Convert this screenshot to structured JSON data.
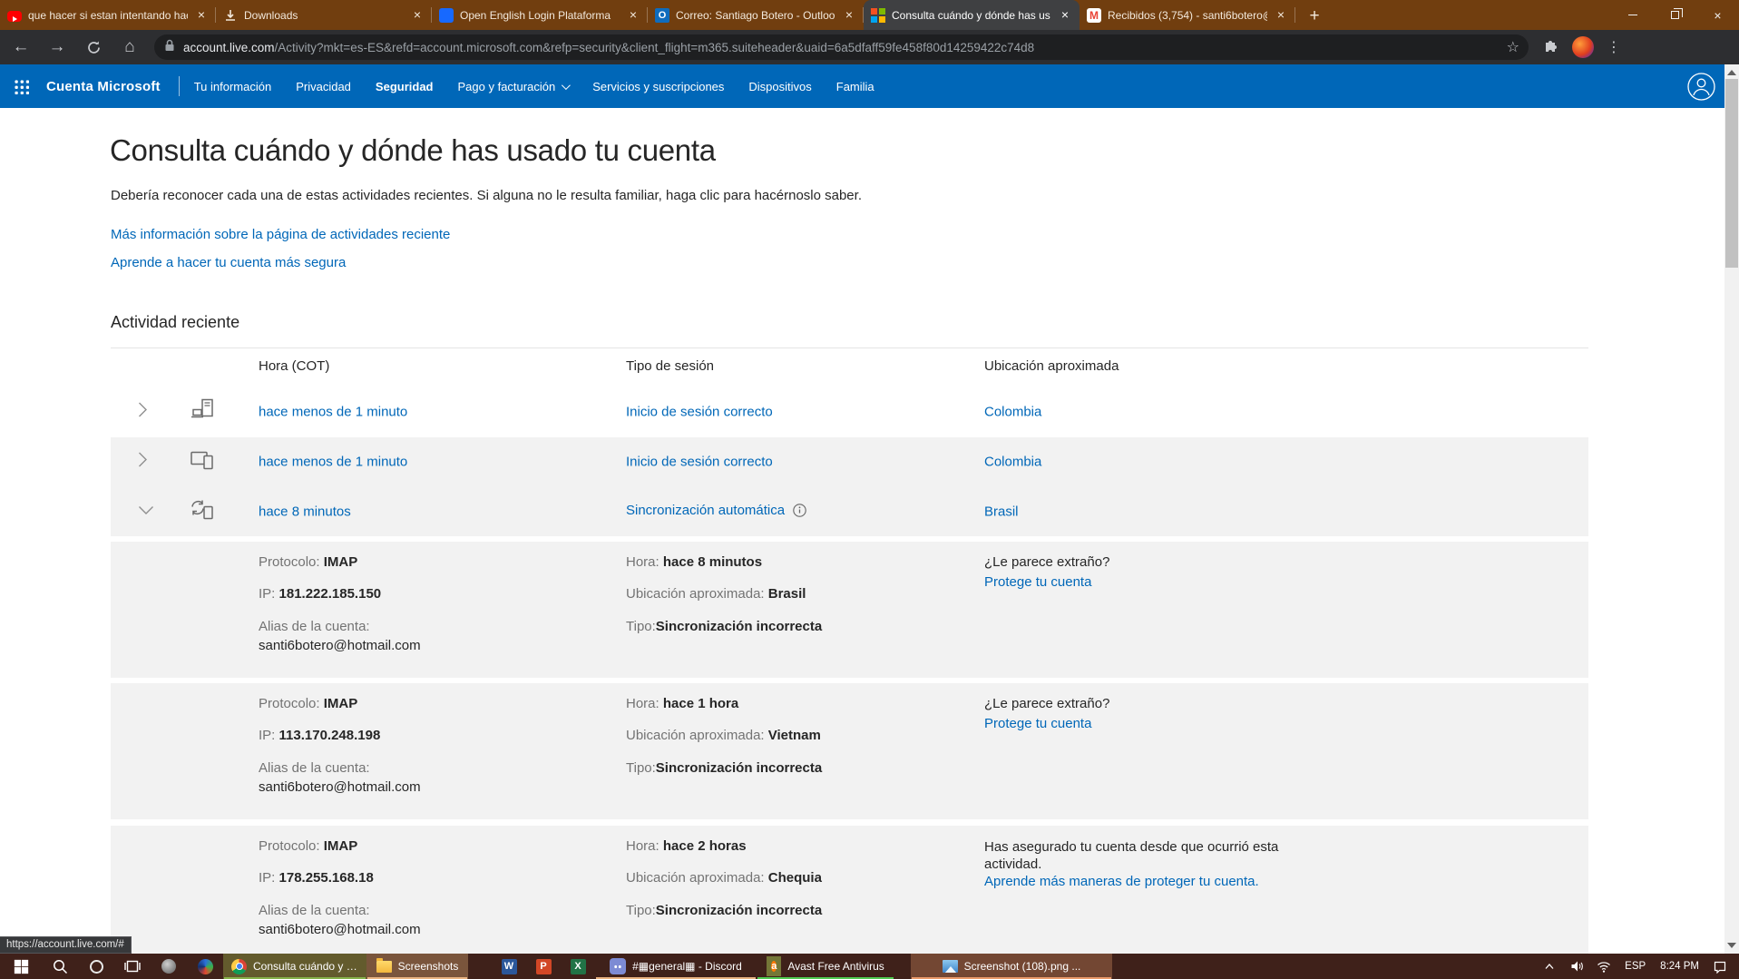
{
  "glyphs": {
    "back": "←",
    "forward": "→",
    "home": "⌂",
    "star": "☆",
    "kebab": "⋮",
    "new_tab": "+",
    "close": "×",
    "outlook": "O",
    "gmail": "M",
    "word": "W",
    "powerpoint": "P",
    "excel": "X",
    "avast": "a"
  },
  "browser": {
    "tabs": [
      {
        "title": "que hacer si estan intentando hac"
      },
      {
        "title": "Downloads"
      },
      {
        "title": "Open English Login Plataforma"
      },
      {
        "title": "Correo: Santiago Botero - Outloo"
      },
      {
        "title": "Consulta cuándo y dónde has us"
      },
      {
        "title": "Recibidos (3,754) - santi6botero@"
      }
    ],
    "url_domain": "account.live.com",
    "url_path": "/Activity?mkt=es-ES&refd=account.microsoft.com&refp=security&client_flight=m365.suiteheader&uaid=6a5dfaff59fe458f80d14259422c74d8"
  },
  "suite_header": {
    "brand": "Cuenta Microsoft",
    "nav": [
      {
        "label": "Tu información"
      },
      {
        "label": "Privacidad"
      },
      {
        "label": "Seguridad"
      },
      {
        "label": "Pago y facturación"
      },
      {
        "label": "Servicios y suscripciones"
      },
      {
        "label": "Dispositivos"
      },
      {
        "label": "Familia"
      }
    ]
  },
  "page": {
    "title": "Consulta cuándo y dónde has usado tu cuenta",
    "intro": "Debería reconocer cada una de estas actividades recientes. Si alguna no le resulta familiar, haga clic para hacérnoslo saber.",
    "link_more": "Más información sobre la página de actividades reciente",
    "link_secure": "Aprende a hacer tu cuenta más segura",
    "section_title": "Actividad reciente",
    "table": {
      "headers": [
        "Hora (COT)",
        "Tipo de sesión",
        "Ubicación aproximada"
      ],
      "rows": [
        {
          "time": "hace menos de 1 minuto",
          "type": "Inicio de sesión correcto",
          "location": "Colombia"
        },
        {
          "time": "hace menos de 1 minuto",
          "type": "Inicio de sesión correcto",
          "location": "Colombia"
        },
        {
          "time": "hace 8 minutos",
          "type": "Sincronización automática",
          "location": "Brasil"
        }
      ]
    },
    "labels": {
      "protocol": "Protocolo:",
      "ip": "IP:",
      "alias": "Alias de la cuenta:",
      "time": "Hora:",
      "location": "Ubicación aproximada:",
      "type": "Tipo:"
    },
    "details": [
      {
        "protocol": "IMAP",
        "ip": "181.222.185.150",
        "alias": "santi6botero@hotmail.com",
        "time": "hace 8 minutos",
        "location": "Brasil",
        "type": "Sincronización incorrecta",
        "question": "¿Le parece extraño?",
        "action": "Protege tu cuenta"
      },
      {
        "protocol": "IMAP",
        "ip": "113.170.248.198",
        "alias": "santi6botero@hotmail.com",
        "time": "hace 1 hora",
        "location": "Vietnam",
        "type": "Sincronización incorrecta",
        "question": "¿Le parece extraño?",
        "action": "Protege tu cuenta"
      },
      {
        "protocol": "IMAP",
        "ip": "178.255.168.18",
        "alias": "santi6botero@hotmail.com",
        "time": "hace 2 horas",
        "location": "Chequia",
        "type": "Sincronización incorrecta",
        "note": "Has asegurado tu cuenta desde que ocurrió esta actividad.",
        "action": "Aprende más maneras de proteger tu cuenta."
      }
    ],
    "status_tooltip": "https://account.live.com/#"
  },
  "taskbar": {
    "chrome_window": "Consulta cuándo y d...",
    "screenshots": "Screenshots",
    "discord": "#▦general▦ - Discord",
    "avast": "Avast Free Antivirus",
    "screenshot_file": "Screenshot (108).png ...",
    "tray": {
      "language": "ESP",
      "time": "8:24 PM"
    }
  }
}
